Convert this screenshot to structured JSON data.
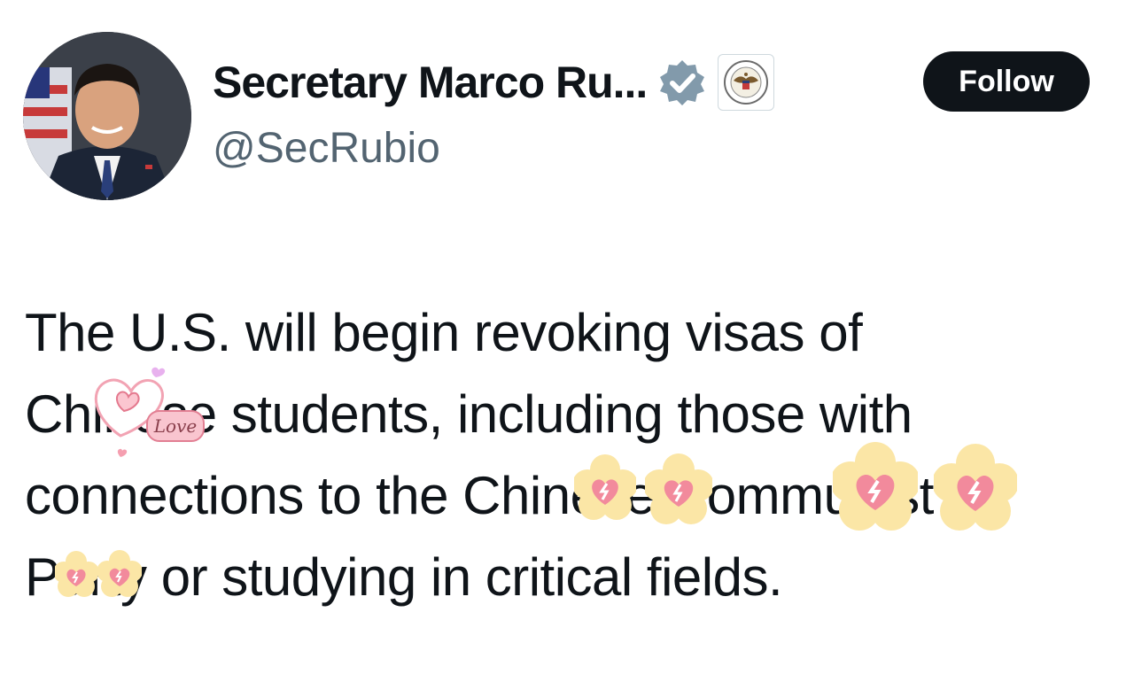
{
  "author": {
    "display_name": "Secretary Marco Ru...",
    "handle": "@SecRubio",
    "avatar": "profile-photo",
    "verified_icon": "verified-check-icon",
    "affiliation_icon": "department-of-state-seal-icon"
  },
  "follow_label": "Follow",
  "tweet": {
    "lines": [
      "The U.S. will begin revoking visas of",
      "Chinese students, including those with",
      "connections to the Chinese Communist",
      "Party or studying in critical fields."
    ]
  },
  "stickers": {
    "love_sticker_text": "Love",
    "heart_icon": "broken-heart-flower-icon"
  },
  "colors": {
    "text": "#0f1419",
    "secondary_text": "#536471",
    "follow_bg": "#0f1419",
    "verified": "#829aab",
    "sticker_flower": "#fbe6a6",
    "sticker_heart": "#f28a9c"
  }
}
